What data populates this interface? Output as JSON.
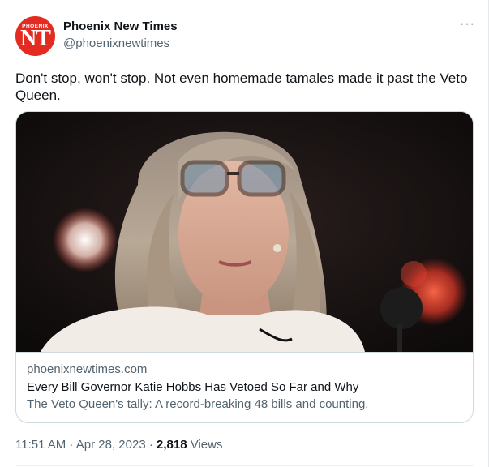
{
  "account": {
    "display_name": "Phoenix New Times",
    "handle": "@phoenixnewtimes",
    "avatar_small_text": "PHOENIX",
    "avatar_big_text": "NT",
    "avatar_color": "#e32b22"
  },
  "more_menu": {
    "label": "···",
    "icon": "more-horizontal-icon"
  },
  "tweet": {
    "text": "Don't stop, won't stop. Not even homemade tamales made it past the Veto Queen."
  },
  "link_card": {
    "domain": "phoenixnewtimes.com",
    "title": "Every Bill Governor Katie Hobbs Has Vetoed So Far and Why",
    "description": "The Veto Queen's tally: A record-breaking 48 bills and counting."
  },
  "meta": {
    "time": "11:51 AM",
    "separator": " · ",
    "date": "Apr 28, 2023",
    "separator2": " · ",
    "views_count": "2,818",
    "views_label": " Views"
  }
}
